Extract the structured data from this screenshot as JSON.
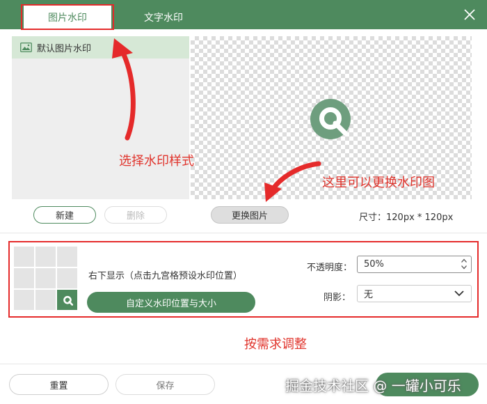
{
  "tabs": {
    "image_watermark": "图片水印",
    "text_watermark": "文字水印"
  },
  "list": {
    "default_item": "默认图片水印"
  },
  "buttons": {
    "new": "新建",
    "delete": "删除",
    "change_image": "更换图片",
    "custom_position": "自定义水印位置与大小",
    "reset": "重置",
    "save": "保存"
  },
  "size_text": "尺寸：120px * 120px",
  "position": {
    "text": "右下显示（点击九宫格预设水印位置）",
    "selected_cell": "bottom-right"
  },
  "opacity": {
    "label": "不透明度：",
    "value": "50%"
  },
  "shadow": {
    "label": "阴影：",
    "value": "无"
  },
  "annotations": {
    "select_style": "选择水印样式",
    "change_here": "这里可以更换水印图",
    "adjust": "按需求调整"
  },
  "credit": "掘金技术社区 @ 一罐小可乐",
  "icons": {
    "close": "close-icon",
    "image": "image-icon",
    "logo": "watermark-logo-icon",
    "spinner": "spinner-arrows-icon",
    "chevron": "chevron-down-icon"
  },
  "colors": {
    "primary_green": "#4e8a5e",
    "annotation_red": "#e52a2a"
  }
}
